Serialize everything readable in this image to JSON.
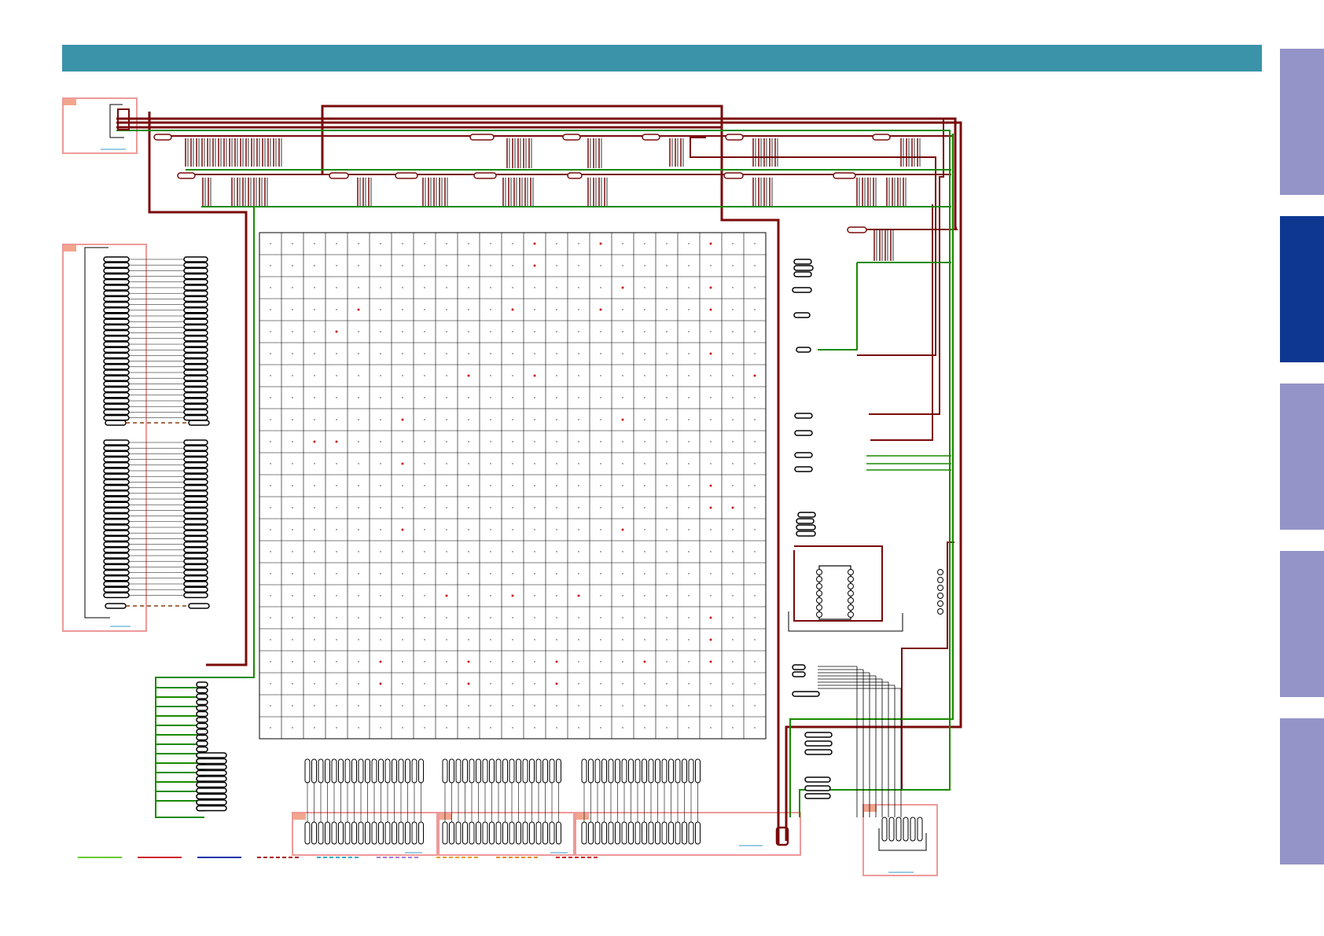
{
  "colors": {
    "header": "#3a93a8",
    "tab_inactive": "#9494c8",
    "tab_active": "#0e3791",
    "wire_red": "#7a0b0b",
    "wire_green": "#1a8a00",
    "box_pink": "#ee9999",
    "box_tag": "#f2a58c",
    "link_blue": "#3399cc",
    "matrix_dot_red": "#c81e1e"
  },
  "header": {
    "title": ""
  },
  "side_tabs": [
    {
      "id": "tab-1",
      "active": false
    },
    {
      "id": "tab-2",
      "active": true
    },
    {
      "id": "tab-3",
      "active": false
    },
    {
      "id": "tab-4",
      "active": false
    },
    {
      "id": "tab-5",
      "active": false
    }
  ],
  "legend": [
    {
      "color": "#66cc33",
      "style": "solid"
    },
    {
      "color": "#cc2222",
      "style": "solid"
    },
    {
      "color": "#1133aa",
      "style": "solid"
    },
    {
      "color": "#aa1111",
      "style": "dashed"
    },
    {
      "color": "#33aacc",
      "style": "dashed"
    },
    {
      "color": "#aa77dd",
      "style": "dashed"
    },
    {
      "color": "#ee9922",
      "style": "dashed"
    },
    {
      "color": "#ee8811",
      "style": "dashed"
    },
    {
      "color": "#cc1111",
      "style": "dashed"
    }
  ],
  "matrix": {
    "rows": 23,
    "cols": 23
  }
}
